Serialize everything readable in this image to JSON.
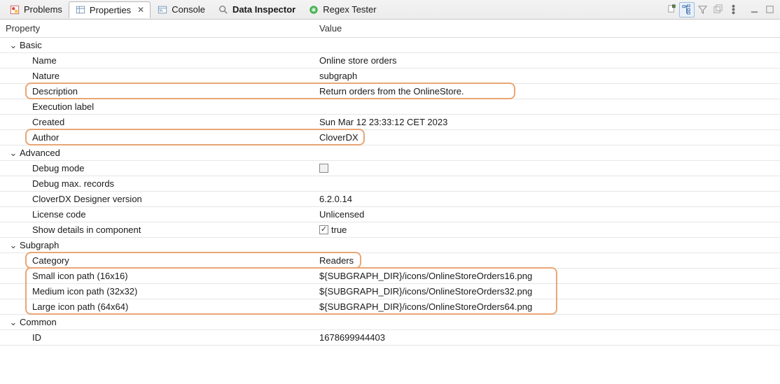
{
  "tabs": {
    "problems": "Problems",
    "properties": "Properties",
    "console": "Console",
    "data_inspector": "Data Inspector",
    "regex_tester": "Regex Tester"
  },
  "columns": {
    "property": "Property",
    "value": "Value"
  },
  "groups": {
    "basic": {
      "label": "Basic",
      "rows": [
        {
          "p": "Name",
          "v": "Online store orders"
        },
        {
          "p": "Nature",
          "v": "subgraph"
        },
        {
          "p": "Description",
          "v": "Return orders from the OnlineStore."
        },
        {
          "p": "Execution label",
          "v": ""
        },
        {
          "p": "Created",
          "v": "Sun Mar 12 23:33:12 CET 2023"
        },
        {
          "p": "Author",
          "v": "CloverDX"
        }
      ]
    },
    "advanced": {
      "label": "Advanced",
      "rows": [
        {
          "p": "Debug mode",
          "v": "",
          "checkbox": "dim"
        },
        {
          "p": "Debug max. records",
          "v": ""
        },
        {
          "p": "CloverDX Designer version",
          "v": "6.2.0.14"
        },
        {
          "p": "License code",
          "v": "Unlicensed"
        },
        {
          "p": "Show details in component",
          "v": "true",
          "checkbox": "checked"
        }
      ]
    },
    "subgraph": {
      "label": "Subgraph",
      "rows": [
        {
          "p": "Category",
          "v": "Readers"
        },
        {
          "p": "Small icon path (16x16)",
          "v": "${SUBGRAPH_DIR}/icons/OnlineStoreOrders16.png"
        },
        {
          "p": "Medium icon path (32x32)",
          "v": "${SUBGRAPH_DIR}/icons/OnlineStoreOrders32.png"
        },
        {
          "p": "Large icon path (64x64)",
          "v": "${SUBGRAPH_DIR}/icons/OnlineStoreOrders64.png"
        }
      ]
    },
    "common": {
      "label": "Common",
      "rows": [
        {
          "p": "ID",
          "v": "1678699944403"
        }
      ]
    }
  }
}
